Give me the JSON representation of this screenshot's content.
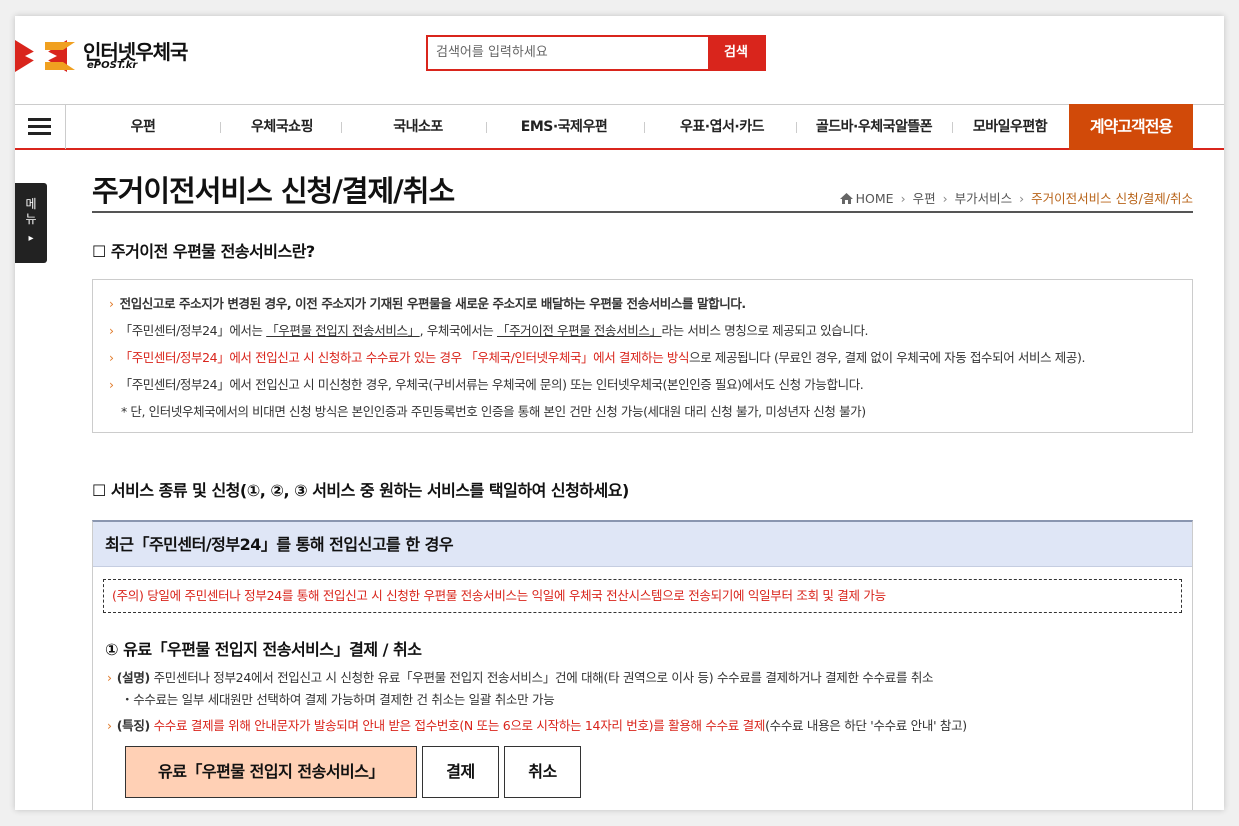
{
  "header": {
    "logo_name": "인터넷우체국",
    "logo_sub": "ePOST.kr",
    "search_placeholder": "검색어를 입력하세요",
    "search_button": "검색"
  },
  "nav": {
    "items": [
      "우편",
      "우체국쇼핑",
      "국내소포",
      "EMS·국제우편",
      "우표·엽서·카드",
      "골드바·우체국알뜰폰",
      "모바일우편함"
    ],
    "special": "계약고객전용"
  },
  "side_tab": {
    "line1": "메",
    "line2": "뉴",
    "arrow": "▸"
  },
  "page": {
    "title": "주거이전서비스 신청/결제/취소",
    "breadcrumb": [
      "HOME",
      "우편",
      "부가서비스",
      "주거이전서비스 신청/결제/취소"
    ]
  },
  "section1": {
    "heading": "☐ 주거이전 우편물 전송서비스란?",
    "lines": [
      {
        "text": "전입신고로 주소지가 변경된 경우, 이전 주소지가 기재된 우편물을 새로운 주소지로 배달하는 우편물 전송서비스를 말합니다."
      },
      {
        "a": "「주민센터/정부24」에서는 ",
        "b": "「우편물 전입지 전송서비스」",
        "c": ", 우체국에서는 ",
        "d": "「주거이전 우편물 전송서비스」",
        "e": "라는 서비스 명칭으로 제공되고 있습니다."
      },
      {
        "red": "「주민센터/정부24」에서 전입신고 시 신청하고 수수료가 있는 경우 「우체국/인터넷우체국」에서 결제하는 방식",
        "rest": "으로 제공됩니다 (무료인 경우, 결제 없이 우체국에 자동 접수되어 서비스 제공)."
      },
      {
        "text": "「주민센터/정부24」에서 전입신고 시 미신청한 경우, 우체국(구비서류는 우체국에 문의) 또는 인터넷우체국(본인인증 필요)에서도 신청 가능합니다."
      },
      {
        "text": "* 단, 인터넷우체국에서의 비대면 신청 방식은 본인인증과 주민등록번호 인증을 통해 본인 건만 신청 가능(세대원 대리 신청 불가, 미성년자 신청 불가)"
      }
    ]
  },
  "section2": {
    "heading": "☐ 서비스 종류 및 신청(①, ②, ③ 서비스 중 원하는 서비스를 택일하여 신청하세요)",
    "panel_title": "최근「주민센터/정부24」를 통해 전입신고를 한 경우",
    "notice": "(주의) 당일에 주민센터나 정부24를 통해 전입신고 시 신청한 우편물 전송서비스는 익일에 우체국 전산시스템으로 전송되기에 익일부터 조회 및 결제 가능",
    "sub_title": "① 유료「우편물 전입지 전송서비스」결제 / 취소",
    "desc1_label": "(설명)",
    "desc1": " 주민센터나 정부24에서 전입신고 시 신청한 유료「우편물 전입지 전송서비스」건에 대해(타 권역으로 이사 등) 수수료를 결제하거나 결제한 수수료를 취소",
    "desc1b": "・수수료는 일부 세대원만 선택하여 결제 가능하며 결제한 건 취소는 일괄 취소만 가능",
    "desc2_label": "(특징)",
    "desc2_red": " 수수료 결제를 위해 안내문자가 발송되며 안내 받은 접수번호(N 또는 6으로 시작하는 14자리 번호)를 활용해 수수료 결제",
    "desc2_rest": "(수수료 내용은 하단 '수수료 안내' 참고)",
    "btn_main": "유료「우편물 전입지 전송서비스」",
    "btn_pay": "결제",
    "btn_cancel": "취소"
  },
  "colors": {
    "accent": "#d9251c",
    "special": "#d14a09",
    "panel_head": "#dfe6f6"
  }
}
